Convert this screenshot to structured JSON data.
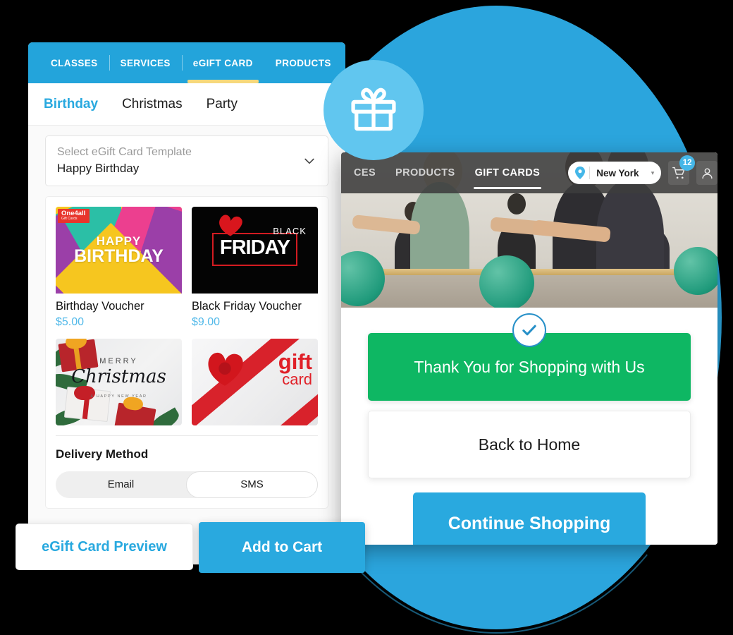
{
  "left_panel": {
    "top_tabs": [
      {
        "label": "CLASSES",
        "active": false
      },
      {
        "label": "SERVICES",
        "active": false
      },
      {
        "label": "eGIFT CARD",
        "active": true
      },
      {
        "label": "PRODUCTS",
        "active": false
      }
    ],
    "sub_tabs": [
      {
        "label": "Birthday",
        "active": true
      },
      {
        "label": "Christmas",
        "active": false
      },
      {
        "label": "Party",
        "active": false
      }
    ],
    "template_select": {
      "label": "Select eGift Card Template",
      "value": "Happy Birthday",
      "chevron_icon": "chevron-down-icon"
    },
    "cards": [
      {
        "art": "birthday",
        "title": "Birthday Voucher",
        "price": "$5.00",
        "art_text": {
          "brand": "One4all",
          "brand_sub": "Gift Cards",
          "line1": "HAPPY",
          "line2": "BIRTHDAY"
        }
      },
      {
        "art": "blackfriday",
        "title": "Black Friday Voucher",
        "price": "$9.00",
        "art_text": {
          "line1": "BLACK",
          "line2": "FRIDAY"
        }
      },
      {
        "art": "christmas",
        "title": "",
        "price": "",
        "art_text": {
          "line1": "MERRY",
          "line2": "Christmas",
          "line3": "& HAPPY NEW YEAR"
        }
      },
      {
        "art": "giftcard",
        "title": "",
        "price": "",
        "art_text": {
          "line1": "gift",
          "line2": "card"
        }
      }
    ],
    "delivery": {
      "title": "Delivery Method",
      "options": [
        {
          "label": "Email",
          "active": false
        },
        {
          "label": "SMS",
          "active": true
        }
      ]
    },
    "preview_button": "eGift Card Preview",
    "add_to_cart_button": "Add  to Cart"
  },
  "gift_badge": {
    "icon": "gift-icon",
    "color": "#61c6ef"
  },
  "right_panel": {
    "nav": [
      {
        "label": "CES",
        "active": false
      },
      {
        "label": "PRODUCTS",
        "active": false
      },
      {
        "label": "GIFT CARDS",
        "active": true
      }
    ],
    "location": {
      "pin_icon": "map-pin-icon",
      "value": "New York",
      "caret_icon": "caret-down-icon"
    },
    "cart": {
      "icon": "cart-icon",
      "badge": "12"
    },
    "account": {
      "icon": "user-icon"
    },
    "hero_image_alt": "barre fitness class",
    "thank_you": {
      "text": "Thank You for Shopping with Us",
      "check_icon": "check-icon",
      "color": "#0eb763"
    },
    "back_home_button": "Back to Home",
    "continue_button": "Continue Shopping"
  },
  "colors": {
    "brand_blue": "#29a9df",
    "blob_blue": "#2ba5dd",
    "badge_blue": "#61c6ef",
    "success_green": "#0eb763",
    "accent_yellow": "#f6d87c",
    "nav_dark": "rgba(60,60,60,.88)"
  }
}
